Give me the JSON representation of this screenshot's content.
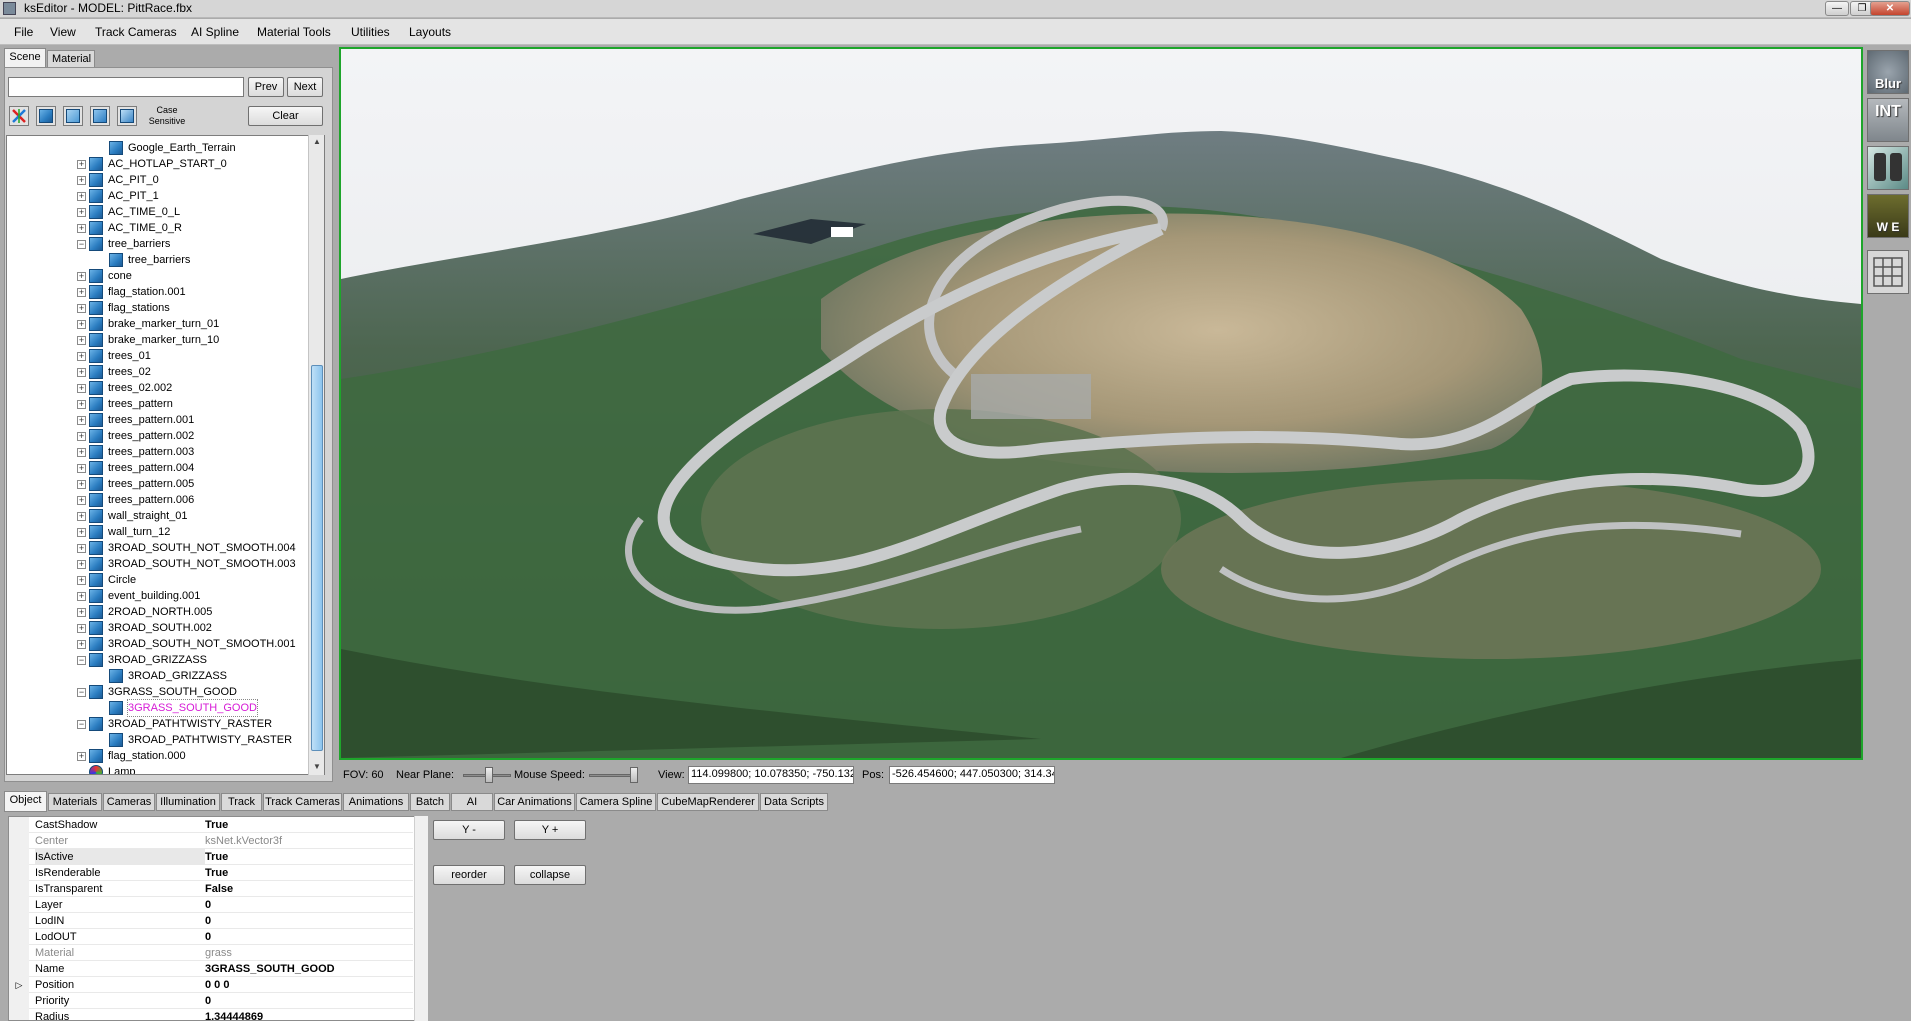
{
  "window": {
    "title": "ksEditor - MODEL: PittRace.fbx",
    "minimize": "—",
    "restore": "❐",
    "close": "✕"
  },
  "menu": [
    "File",
    "View",
    "Track Cameras",
    "AI Spline",
    "Material Tools",
    "Utilities",
    "Layouts"
  ],
  "left_tabs": [
    "Scene",
    "Material"
  ],
  "search": {
    "value": "",
    "prev": "Prev",
    "next": "Next",
    "case_label": "Case Sensitive",
    "clear": "Clear"
  },
  "tree": [
    {
      "label": "Google_Earth_Terrain",
      "level": 2,
      "expander": ""
    },
    {
      "label": "AC_HOTLAP_START_0",
      "level": 1,
      "expander": "+"
    },
    {
      "label": "AC_PIT_0",
      "level": 1,
      "expander": "+"
    },
    {
      "label": "AC_PIT_1",
      "level": 1,
      "expander": "+"
    },
    {
      "label": "AC_TIME_0_L",
      "level": 1,
      "expander": "+"
    },
    {
      "label": "AC_TIME_0_R",
      "level": 1,
      "expander": "+"
    },
    {
      "label": "tree_barriers",
      "level": 1,
      "expander": "−"
    },
    {
      "label": "tree_barriers",
      "level": 2,
      "expander": ""
    },
    {
      "label": "cone",
      "level": 1,
      "expander": "+"
    },
    {
      "label": "flag_station.001",
      "level": 1,
      "expander": "+"
    },
    {
      "label": "flag_stations",
      "level": 1,
      "expander": "+"
    },
    {
      "label": "brake_marker_turn_01",
      "level": 1,
      "expander": "+"
    },
    {
      "label": "brake_marker_turn_10",
      "level": 1,
      "expander": "+"
    },
    {
      "label": "trees_01",
      "level": 1,
      "expander": "+"
    },
    {
      "label": "trees_02",
      "level": 1,
      "expander": "+"
    },
    {
      "label": "trees_02.002",
      "level": 1,
      "expander": "+"
    },
    {
      "label": "trees_pattern",
      "level": 1,
      "expander": "+"
    },
    {
      "label": "trees_pattern.001",
      "level": 1,
      "expander": "+"
    },
    {
      "label": "trees_pattern.002",
      "level": 1,
      "expander": "+"
    },
    {
      "label": "trees_pattern.003",
      "level": 1,
      "expander": "+"
    },
    {
      "label": "trees_pattern.004",
      "level": 1,
      "expander": "+"
    },
    {
      "label": "trees_pattern.005",
      "level": 1,
      "expander": "+"
    },
    {
      "label": "trees_pattern.006",
      "level": 1,
      "expander": "+"
    },
    {
      "label": "wall_straight_01",
      "level": 1,
      "expander": "+"
    },
    {
      "label": "wall_turn_12",
      "level": 1,
      "expander": "+"
    },
    {
      "label": "3ROAD_SOUTH_NOT_SMOOTH.004",
      "level": 1,
      "expander": "+"
    },
    {
      "label": "3ROAD_SOUTH_NOT_SMOOTH.003",
      "level": 1,
      "expander": "+"
    },
    {
      "label": "Circle",
      "level": 1,
      "expander": "+"
    },
    {
      "label": "event_building.001",
      "level": 1,
      "expander": "+"
    },
    {
      "label": "2ROAD_NORTH.005",
      "level": 1,
      "expander": "+"
    },
    {
      "label": "3ROAD_SOUTH.002",
      "level": 1,
      "expander": "+"
    },
    {
      "label": "3ROAD_SOUTH_NOT_SMOOTH.001",
      "level": 1,
      "expander": "+"
    },
    {
      "label": "3ROAD_GRIZZASS",
      "level": 1,
      "expander": "−"
    },
    {
      "label": "3ROAD_GRIZZASS",
      "level": 2,
      "expander": ""
    },
    {
      "label": "3GRASS_SOUTH_GOOD",
      "level": 1,
      "expander": "−"
    },
    {
      "label": "3GRASS_SOUTH_GOOD",
      "level": 2,
      "expander": "",
      "selected": true
    },
    {
      "label": "3ROAD_PATHTWISTY_RASTER",
      "level": 1,
      "expander": "−"
    },
    {
      "label": "3ROAD_PATHTWISTY_RASTER",
      "level": 2,
      "expander": ""
    },
    {
      "label": "flag_station.000",
      "level": 1,
      "expander": "+"
    },
    {
      "label": "Lamp",
      "level": 1,
      "expander": "",
      "lamp": true
    }
  ],
  "viewport_status": {
    "fov": "FOV: 60",
    "near_plane": "Near Plane:",
    "mouse_speed": "Mouse Speed:",
    "view_label": "View:",
    "view_value": "114.099800; 10.078350; -750.132",
    "pos_label": "Pos:",
    "pos_value": "-526.454600; 447.050300; 314.34"
  },
  "right_toolbar": [
    "Blur",
    "INT",
    "",
    "W E",
    ""
  ],
  "bottom_tabs": [
    "Object",
    "Materials",
    "Cameras",
    "Illumination",
    "Track",
    "Track Cameras",
    "Animations",
    "Batch",
    "AI",
    "Car Animations",
    "Camera Spline",
    "CubeMapRenderer",
    "Data Scripts"
  ],
  "properties": [
    {
      "name": "CastShadow",
      "value": "True"
    },
    {
      "name": "Center",
      "value": "ksNet.kVector3f",
      "disabled": true
    },
    {
      "name": "IsActive",
      "value": "True",
      "highlight": true
    },
    {
      "name": "IsRenderable",
      "value": "True"
    },
    {
      "name": "IsTransparent",
      "value": "False"
    },
    {
      "name": "Layer",
      "value": "0"
    },
    {
      "name": "LodIN",
      "value": "0"
    },
    {
      "name": "LodOUT",
      "value": "0"
    },
    {
      "name": "Material",
      "value": "grass",
      "disabled": true
    },
    {
      "name": "Name",
      "value": "3GRASS_SOUTH_GOOD"
    },
    {
      "name": "Position",
      "value": "0 0 0",
      "expandable": true
    },
    {
      "name": "Priority",
      "value": "0"
    },
    {
      "name": "Radius",
      "value": "1.34444869"
    }
  ],
  "action_buttons": {
    "y_minus": "Y -",
    "y_plus": "Y +",
    "reorder": "reorder",
    "collapse": "collapse"
  }
}
